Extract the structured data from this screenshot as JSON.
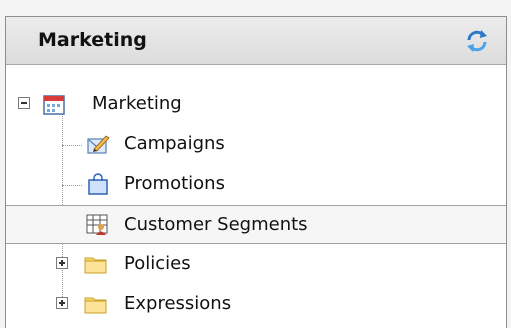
{
  "panel": {
    "title": "Marketing",
    "refresh_icon": "refresh-icon"
  },
  "tree": {
    "root": {
      "label": "Marketing",
      "icon": "marketing-calendar-icon",
      "expanded": true
    },
    "items": [
      {
        "label": "Campaigns",
        "icon": "campaign-edit-icon"
      },
      {
        "label": "Promotions",
        "icon": "shopping-bag-icon"
      },
      {
        "label": "Customer Segments",
        "icon": "customer-segments-icon",
        "selected": true
      },
      {
        "label": "Policies",
        "icon": "folder-icon",
        "expandable": true
      },
      {
        "label": "Expressions",
        "icon": "folder-icon",
        "expandable": true
      }
    ]
  }
}
